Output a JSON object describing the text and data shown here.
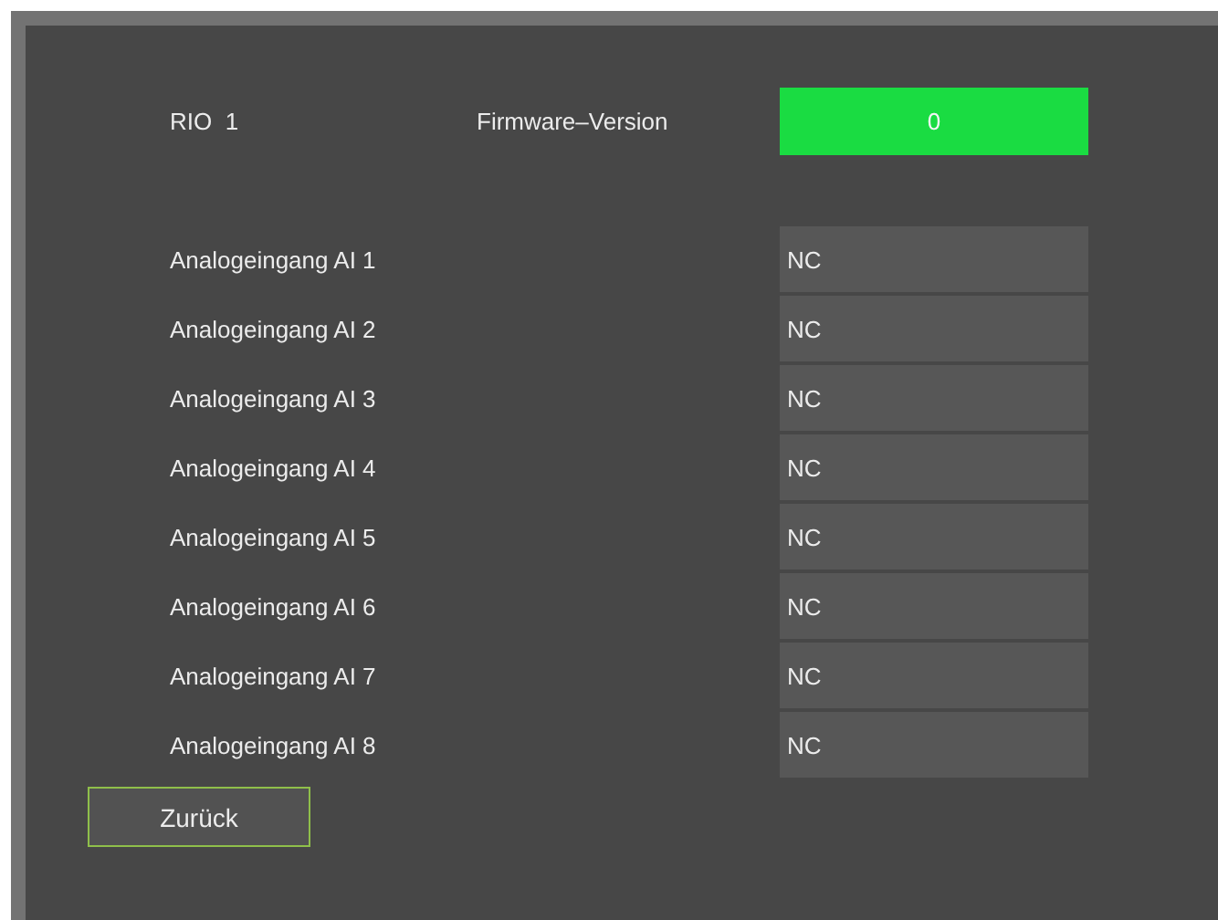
{
  "header": {
    "device": "RIO  1",
    "firmware_label": "Firmware–Version",
    "firmware_value": "0"
  },
  "inputs": [
    {
      "label": "Analogeingang AI 1",
      "value": "NC"
    },
    {
      "label": "Analogeingang AI 2",
      "value": "NC"
    },
    {
      "label": "Analogeingang AI 3",
      "value": "NC"
    },
    {
      "label": "Analogeingang AI 4",
      "value": "NC"
    },
    {
      "label": "Analogeingang AI 5",
      "value": "NC"
    },
    {
      "label": "Analogeingang AI 6",
      "value": "NC"
    },
    {
      "label": "Analogeingang AI 7",
      "value": "NC"
    },
    {
      "label": "Analogeingang AI 8",
      "value": "NC"
    }
  ],
  "buttons": [
    "Zurück"
  ]
}
